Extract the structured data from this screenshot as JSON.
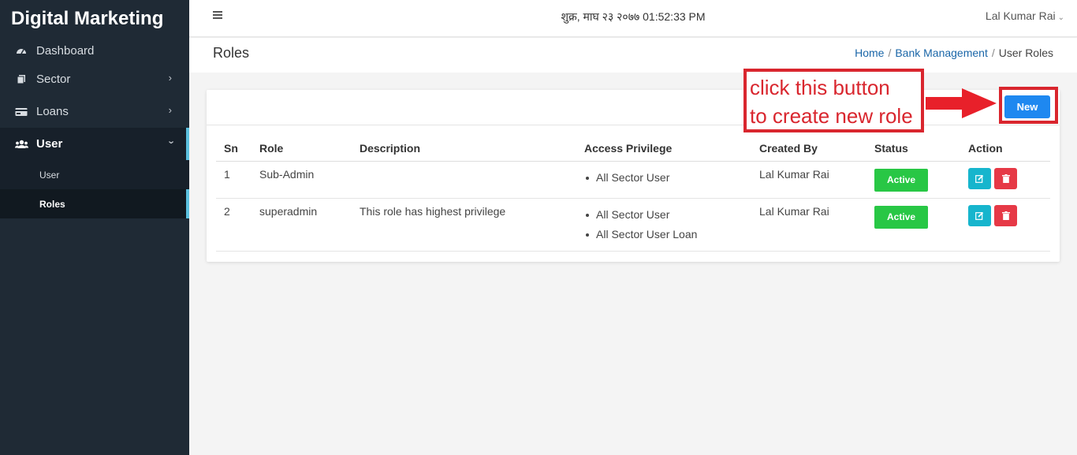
{
  "app": {
    "brand": "Digital Marketing"
  },
  "sidebar": {
    "items": [
      {
        "label": "Dashboard",
        "icon": "dashboard-icon"
      },
      {
        "label": "Sector",
        "icon": "copy-icon"
      },
      {
        "label": "Loans",
        "icon": "card-icon"
      },
      {
        "label": "User",
        "icon": "users-icon"
      }
    ],
    "subitems": [
      {
        "label": "User"
      },
      {
        "label": "Roles"
      }
    ]
  },
  "topbar": {
    "datetime": "शुक्र, माघ २३ २०७७ 01:52:33 PM",
    "user": "Lal Kumar Rai"
  },
  "page": {
    "title": "Roles",
    "breadcrumb": {
      "home": "Home",
      "section": "Bank Management",
      "current": "User Roles"
    }
  },
  "card": {
    "new_label": "New"
  },
  "table": {
    "headers": {
      "sn": "Sn",
      "role": "Role",
      "description": "Description",
      "access": "Access Privilege",
      "created_by": "Created By",
      "status": "Status",
      "action": "Action"
    },
    "rows": [
      {
        "sn": "1",
        "role": "Sub-Admin",
        "description": "",
        "privileges": [
          "All Sector User"
        ],
        "created_by": "Lal Kumar Rai",
        "status": "Active"
      },
      {
        "sn": "2",
        "role": "superadmin",
        "description": "This role has highest privilege",
        "privileges": [
          "All Sector User",
          "All Sector User Loan"
        ],
        "created_by": "Lal Kumar Rai",
        "status": "Active"
      }
    ]
  },
  "annotation": {
    "line1": "click this button",
    "line2": "to create new role"
  },
  "colors": {
    "sidebar": "#1f2a35",
    "accent": "#5bc0de",
    "primary": "#1e88f0",
    "success": "#28c745",
    "info": "#17b5cd",
    "danger": "#e63946",
    "annotation": "#d9262e"
  }
}
